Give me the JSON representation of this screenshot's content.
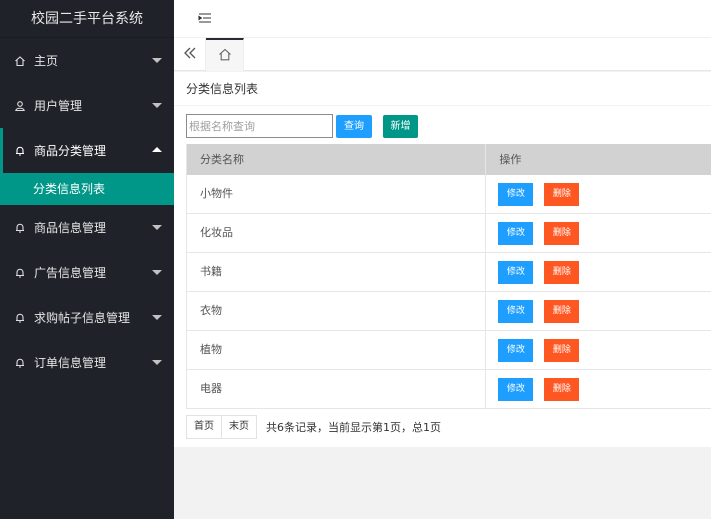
{
  "app": {
    "title": "校园二手平台系统"
  },
  "sidebar": {
    "items": [
      {
        "label": "主页"
      },
      {
        "label": "用户管理"
      },
      {
        "label": "商品分类管理",
        "sub": [
          {
            "label": "分类信息列表"
          }
        ]
      },
      {
        "label": "商品信息管理"
      },
      {
        "label": "广告信息管理"
      },
      {
        "label": "求购帖子信息管理"
      },
      {
        "label": "订单信息管理"
      }
    ]
  },
  "main": {
    "title": "分类信息列表",
    "search": {
      "placeholder": "根据名称查询",
      "value": ""
    },
    "buttons": {
      "query": "查询",
      "add": "新增"
    },
    "table": {
      "headers": [
        "分类名称",
        "操作"
      ],
      "rows": [
        {
          "name": "小物件"
        },
        {
          "name": "化妆品"
        },
        {
          "name": "书籍"
        },
        {
          "name": "衣物"
        },
        {
          "name": "植物"
        },
        {
          "name": "电器"
        }
      ],
      "actions": {
        "edit": "修改",
        "delete": "删除"
      }
    },
    "pagination": {
      "first": "首页",
      "last": "末页",
      "info": "共6条记录，当前显示第1页，总1页"
    }
  },
  "colors": {
    "sidebar_bg": "#20222a",
    "accent": "#009688",
    "primary": "#1e9fff",
    "danger": "#ff5722"
  }
}
